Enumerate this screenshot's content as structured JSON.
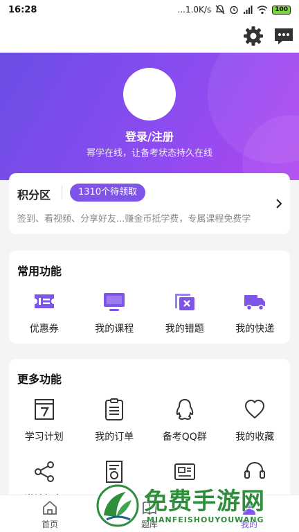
{
  "status_bar": {
    "time": "16:28",
    "network": "...1.0K/s",
    "battery": "100"
  },
  "hero": {
    "login": "登录/注册",
    "slogan": "幂学在线，让备考状态持久在线"
  },
  "points": {
    "title": "积分区",
    "badge": "1310个待领取",
    "desc": "签到、看视频、分享好友...赚金币抵学费，专属课程免费学"
  },
  "common": {
    "title": "常用功能",
    "items": [
      {
        "label": "优惠券",
        "icon": "coupon-icon"
      },
      {
        "label": "我的课程",
        "icon": "course-icon"
      },
      {
        "label": "我的错题",
        "icon": "mistakes-icon"
      },
      {
        "label": "我的快递",
        "icon": "delivery-icon"
      }
    ]
  },
  "more": {
    "title": "更多功能",
    "items": [
      {
        "label": "学习计划",
        "icon": "calendar-icon"
      },
      {
        "label": "我的订单",
        "icon": "order-icon"
      },
      {
        "label": "备考QQ群",
        "icon": "qq-icon"
      },
      {
        "label": "我的收藏",
        "icon": "heart-icon"
      },
      {
        "label": "邀请好友",
        "icon": "share-icon"
      },
      {
        "label": "",
        "icon": "certificate-icon"
      },
      {
        "label": "",
        "icon": "card-icon"
      },
      {
        "label": "",
        "icon": "headset-icon"
      }
    ]
  },
  "nav": [
    {
      "label": "首页",
      "icon": "home-icon"
    },
    {
      "label": "题库",
      "icon": "book-icon"
    },
    {
      "label": "我的",
      "icon": "profile-icon"
    }
  ],
  "watermark": {
    "title": "免费手游网",
    "subtitle": "MIANFEISHOUYOUWANG"
  },
  "colors": {
    "accent": "#7e55e8",
    "hero_start": "#6b4de6",
    "hero_end": "#b146f0"
  }
}
